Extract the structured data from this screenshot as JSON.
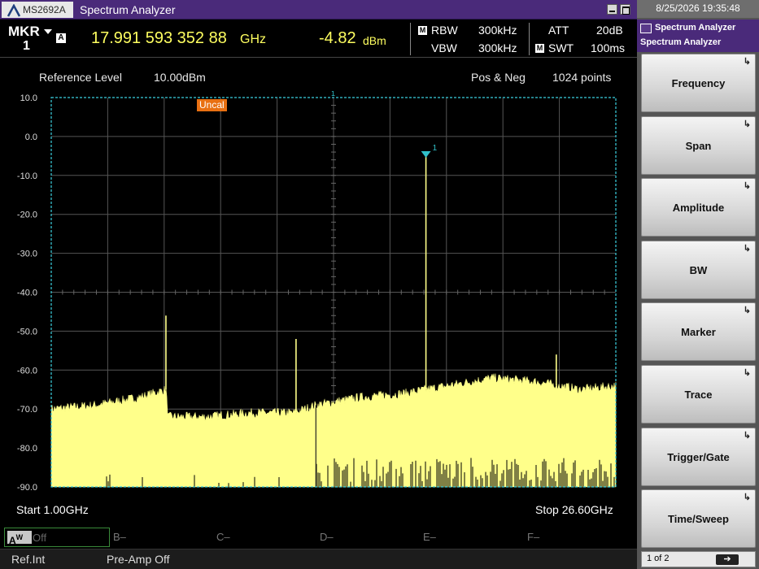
{
  "window": {
    "model": "MS2692A",
    "title": "Spectrum Analyzer"
  },
  "marker": {
    "label": "MKR",
    "number": "1",
    "trace_badge": "A",
    "frequency": "17.991 593 352 88",
    "frequency_unit": "GHz",
    "level": "-4.82",
    "level_unit": "dBm"
  },
  "params": {
    "rbw_badge": "M",
    "rbw_label": "RBW",
    "rbw_value": "300kHz",
    "vbw_label": "VBW",
    "vbw_value": "300kHz",
    "att_label": "ATT",
    "att_value": "20dB",
    "swt_badge": "M",
    "swt_label": "SWT",
    "swt_value": "100ms"
  },
  "graph_info": {
    "ref_label": "Reference Level",
    "ref_value": "10.00dBm",
    "detector": "Pos & Neg",
    "points": "1024 points",
    "uncal": "Uncal",
    "start": "Start 1.00GHz",
    "stop": "Stop 26.60GHz",
    "marker_tag": "1"
  },
  "chart_data": {
    "type": "area",
    "x_unit": "GHz",
    "y_unit": "dBm",
    "xlim": [
      1.0,
      26.6
    ],
    "ylim": [
      -90.0,
      10.0
    ],
    "y_tick_labels": [
      "10.0",
      "0.0",
      "-10.0",
      "-20.0",
      "-30.0",
      "-40.0",
      "-50.0",
      "-60.0",
      "-70.0",
      "-80.0",
      "-90.0"
    ],
    "x_divisions": 10,
    "grid": true,
    "noise_floor": {
      "x": [
        1.0,
        3.0,
        5.0,
        6.2,
        6.3,
        8.0,
        10.0,
        12.0,
        13.0,
        15.0,
        17.0,
        19.0,
        21.0,
        23.0,
        25.0,
        26.6
      ],
      "y": [
        -70.0,
        -69.0,
        -67.0,
        -65.0,
        -72.0,
        -72.0,
        -71.0,
        -71.0,
        -69.0,
        -67.0,
        -66.0,
        -64.0,
        -62.0,
        -63.0,
        -65.0,
        -64.0
      ]
    },
    "spurs": [
      {
        "x": 6.2,
        "y": -46.0
      },
      {
        "x": 12.1,
        "y": -52.0
      },
      {
        "x": 17.99,
        "y": -4.82
      },
      {
        "x": 23.9,
        "y": -56.0
      }
    ],
    "marker": {
      "label": "1",
      "x": 17.99,
      "y": -4.82
    }
  },
  "tracebar": {
    "a_label": "A",
    "a_sup": "W",
    "a_state": "Off",
    "b": "B",
    "c": "C",
    "d": "D",
    "e": "E",
    "f": "F",
    "dash": "–"
  },
  "status": {
    "ref": "Ref.Int",
    "preamp": "Pre-Amp Off"
  },
  "right": {
    "datetime": "8/25/2026 19:35:48",
    "header1": "Spectrum Analyzer",
    "header2": "Spectrum Analyzer",
    "softkeys": [
      "Frequency",
      "Span",
      "Amplitude",
      "BW",
      "Marker",
      "Trace",
      "Trigger/Gate",
      "Time/Sweep"
    ],
    "softkey_indicator": "↳",
    "pager": "1 of 2",
    "next_arrow": "➔"
  },
  "colors": {
    "trace": "#ffff8a",
    "grid_border": "#3bd0e0",
    "marker": "#30c0c8",
    "title_bar": "#4a2a7a",
    "readout": "#ffff60"
  }
}
